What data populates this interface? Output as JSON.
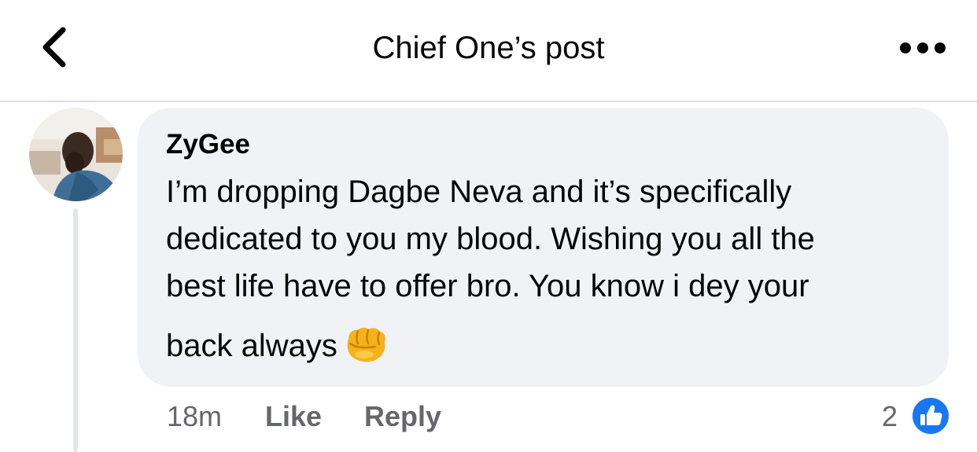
{
  "header": {
    "title": "Chief One’s post",
    "back_icon": "chevron-left-icon",
    "more_icon": "more-horizontal-icon"
  },
  "comment": {
    "author": "ZyGee",
    "lines": [
      "I’m dropping Dagbe Neva and it’s specifically",
      "dedicated to you my blood. Wishing you all the",
      "best life have to offer bro. You know i dey your",
      "back always"
    ],
    "emoji_icon": "raised-fist-emoji-icon",
    "time": "18m",
    "like_label": "Like",
    "reply_label": "Reply",
    "reaction_count": "2",
    "reaction_icon": "like-reaction-icon"
  },
  "colors": {
    "bubble_bg": "#f0f2f5",
    "meta_text": "#65676b",
    "like_blue": "#1877f2",
    "thread_line": "#e4e6eb"
  }
}
